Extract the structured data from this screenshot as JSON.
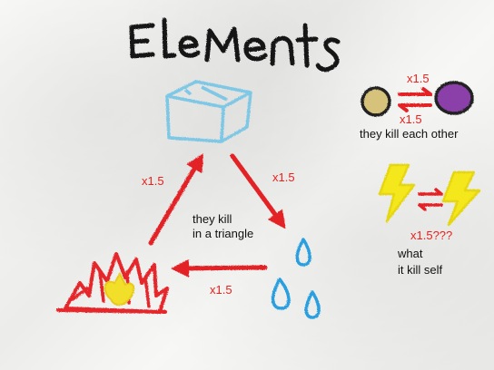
{
  "title": "Elements",
  "labels": {
    "triangle_left": "x1.5",
    "triangle_right": "x1.5",
    "triangle_bottom": "x1.5",
    "triangle_note_line1": "they kill",
    "triangle_note_line2": "in a triangle",
    "orbs_top": "x1.5",
    "orbs_bottom": "x1.5",
    "orbs_note": "they kill each other",
    "lightning_mult": "x1.5???",
    "lightning_note_line1": "what",
    "lightning_note_line2": "it kill self"
  },
  "colors": {
    "title": "#161616",
    "ice": "#7ec8e6",
    "fire": "#e5252b",
    "fire_core": "#f2df2a",
    "water": "#2a9fe0",
    "arrow": "#e32128",
    "orb_light": "#d6c27a",
    "orb_dark": "#8a3fa8",
    "lightning": "#f4e81e",
    "label_red": "#e8211e"
  },
  "icons": [
    "ice-cube-icon",
    "fire-icon",
    "water-drops-icon",
    "light-orb-icon",
    "dark-orb-icon",
    "lightning-icon"
  ]
}
